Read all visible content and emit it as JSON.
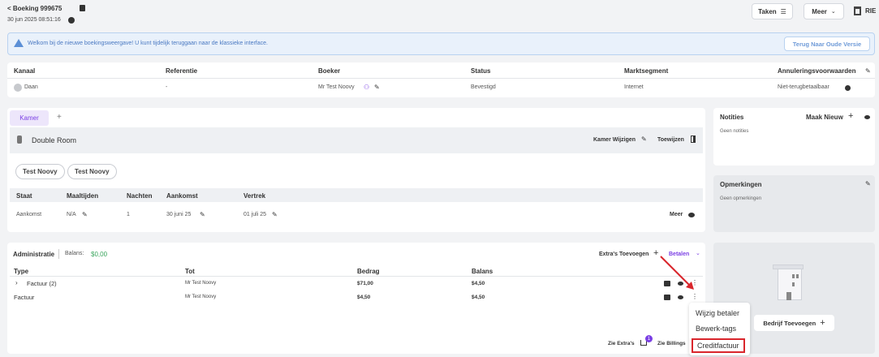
{
  "header": {
    "back_label": "< Boeking 999675",
    "datetime": "30 jun 2025 08:51:16",
    "tasks_label": "Taken",
    "more_label": "Meer",
    "user_label": "RIE"
  },
  "banner": {
    "text": "Welkom bij de nieuwe boekingsweergave! U kunt tijdelijk teruggaan naar de klassieke interface.",
    "button_label": "Terug Naar Oude Versie"
  },
  "info": {
    "headers": {
      "kanaal": "Kanaal",
      "referentie": "Referentie",
      "boeker": "Boeker",
      "status": "Status",
      "segment": "Marktsegment",
      "annulering": "Annuleringsvoorwaarden"
    },
    "values": {
      "kanaal": "Daan",
      "referentie": "-",
      "boeker": "Mr Test Noovy",
      "status": "Bevestigd",
      "segment": "Internet",
      "annulering": "Niet-terugbetaalbaar"
    }
  },
  "room": {
    "tab_label": "Kamer",
    "tab_add": "+",
    "room_name": "Double Room",
    "change_label": "Kamer Wijzigen",
    "assign_label": "Toewijzen",
    "guests": [
      "Test Noovy",
      "Test Noovy"
    ],
    "columns": {
      "staat": "Staat",
      "maaltijden": "Maaltijden",
      "nachten": "Nachten",
      "aankomst": "Aankomst",
      "vertrek": "Vertrek"
    },
    "row": {
      "staat": "Aankomst",
      "maaltijden": "N/A",
      "nachten": "1",
      "aankomst": "30 juni 25",
      "vertrek": "01 juli 25"
    },
    "more_label": "Meer"
  },
  "admin": {
    "title": "Administratie",
    "balance_label": "Balans:",
    "balance_value": "$0,00",
    "extras_label": "Extra's Toevoegen",
    "pay_label": "Betalen",
    "columns": {
      "type": "Type",
      "tot": "Tot",
      "bedrag": "Bedrag",
      "balans": "Balans"
    },
    "rows": [
      {
        "type": "Factuur (2)",
        "tot": "Mr Test Noovy",
        "bedrag": "$71,00",
        "balans": "$4,50"
      },
      {
        "type": "Factuur",
        "tot": "Mr Test Noovy",
        "bedrag": "$4,50",
        "balans": "$4,50"
      }
    ],
    "see_extras": "Zie Extra's",
    "extras_badge": "1",
    "see_billings": "Zie Billings"
  },
  "context_menu": {
    "items": [
      "Wijzig betaler",
      "Bewerk-tags",
      "Creditfactuur"
    ]
  },
  "notes": {
    "title": "Notities",
    "new_label": "Maak Nieuw",
    "empty": "Geen notities"
  },
  "remarks": {
    "title": "Opmerkingen",
    "empty": "Geen opmerkingen"
  },
  "company": {
    "add_label": "Bedrijf Toevoegen"
  },
  "colors": {
    "accent": "#7b3fe4",
    "highlight": "#d9262c",
    "banner_bg": "#e9f1fb",
    "tab_bg": "#ede6fb"
  }
}
